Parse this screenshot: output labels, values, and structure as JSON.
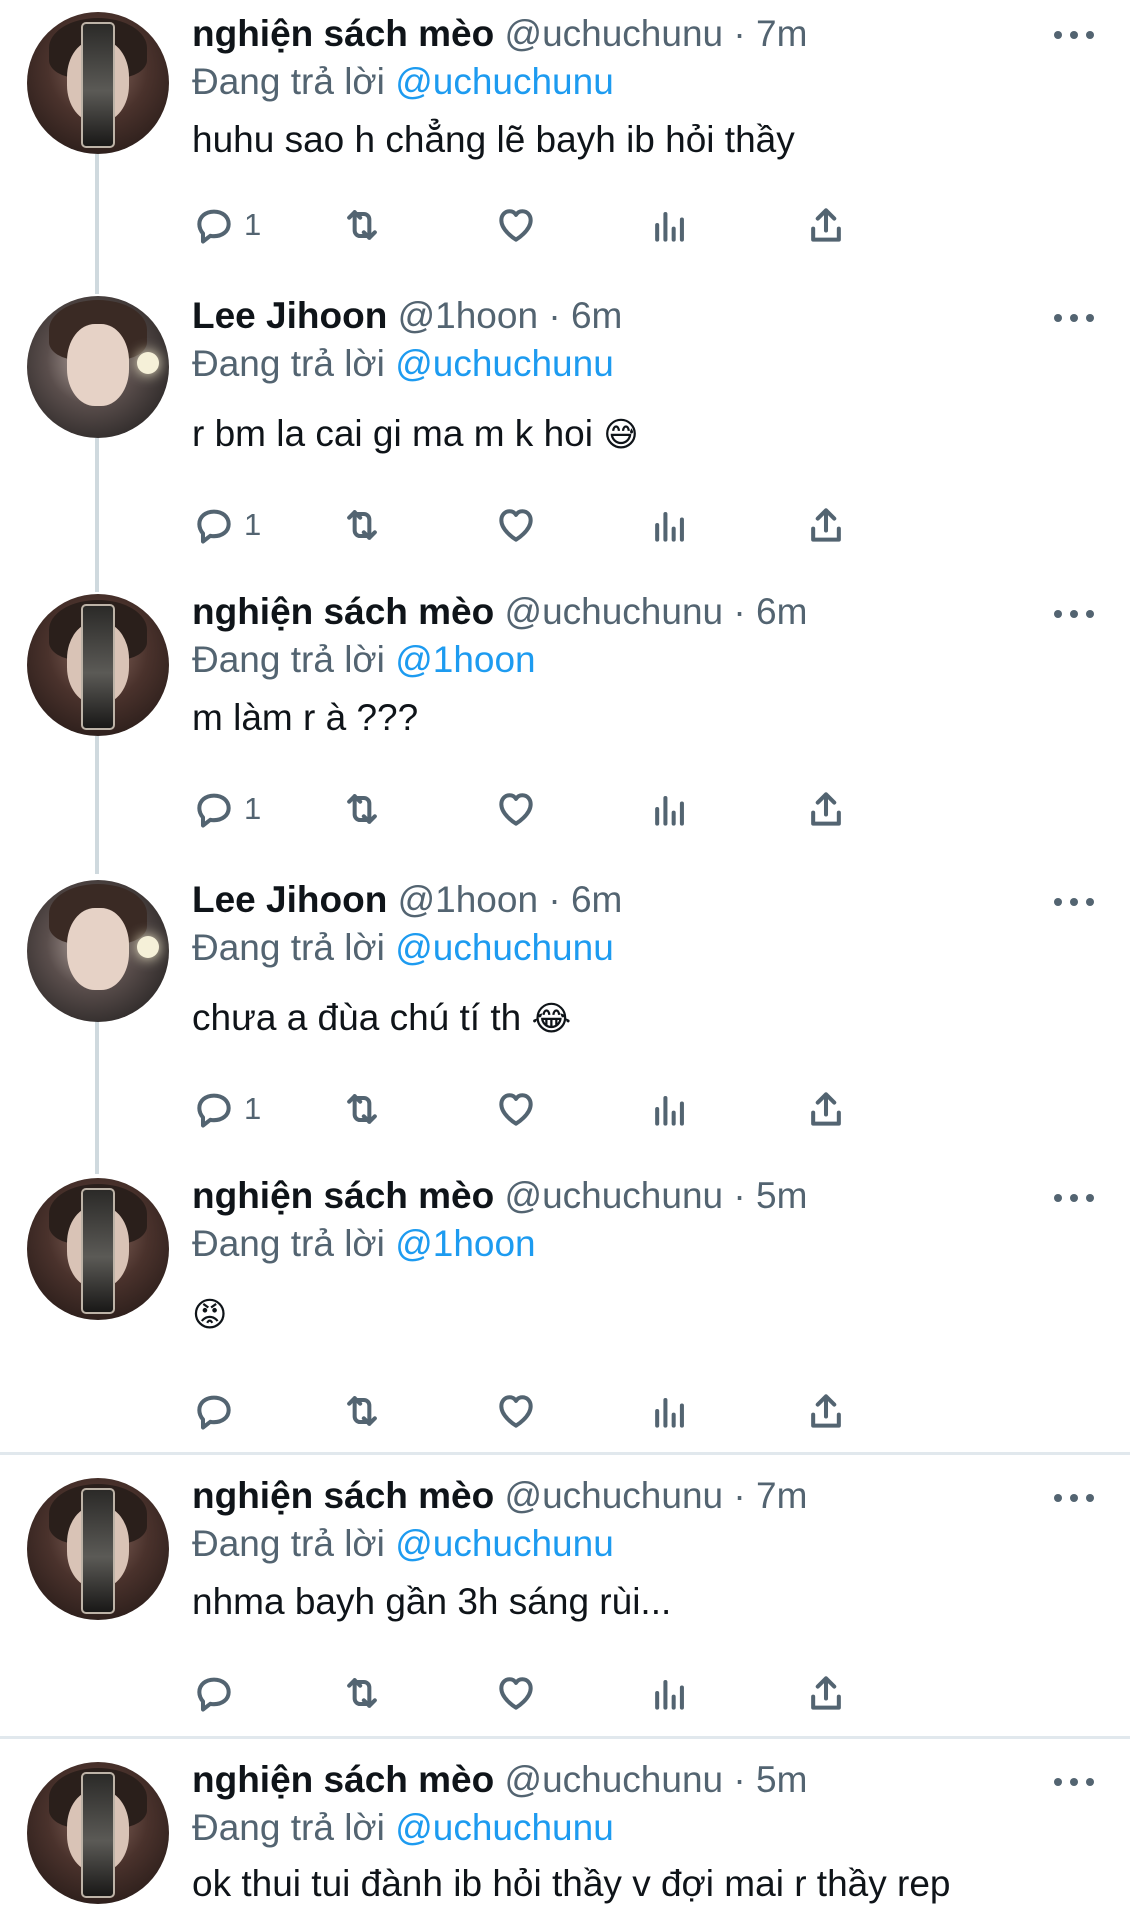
{
  "tweets": [
    {
      "name": "nghiện sách mèo",
      "handle": "@uchuchunu",
      "dot": "·",
      "time": "7m",
      "reply_prefix": "Đang trả lời",
      "reply_to": "@uchuchunu",
      "text": "huhu sao h chẳng lẽ bayh ib hỏi thầy",
      "emoji": "",
      "reply_count": "1"
    },
    {
      "name": "Lee Jihoon",
      "handle": "@1hoon",
      "dot": "·",
      "time": "6m",
      "reply_prefix": "Đang trả lời",
      "reply_to": "@uchuchunu",
      "text": "r bm la cai gi ma m k hoi",
      "emoji": "😅",
      "reply_count": "1"
    },
    {
      "name": "nghiện sách mèo",
      "handle": "@uchuchunu",
      "dot": "·",
      "time": "6m",
      "reply_prefix": "Đang trả lời",
      "reply_to": "@1hoon",
      "text": "m làm r à ???",
      "emoji": "",
      "reply_count": "1"
    },
    {
      "name": "Lee Jihoon",
      "handle": "@1hoon",
      "dot": "·",
      "time": "6m",
      "reply_prefix": "Đang trả lời",
      "reply_to": "@uchuchunu",
      "text": "chưa a đùa chú tí th",
      "emoji": "😂",
      "reply_count": "1"
    },
    {
      "name": "nghiện sách mèo",
      "handle": "@uchuchunu",
      "dot": "·",
      "time": "5m",
      "reply_prefix": "Đang trả lời",
      "reply_to": "@1hoon",
      "text": "",
      "emoji": "😡",
      "reply_count": ""
    },
    {
      "name": "nghiện sách mèo",
      "handle": "@uchuchunu",
      "dot": "·",
      "time": "7m",
      "reply_prefix": "Đang trả lời",
      "reply_to": "@uchuchunu",
      "text": "nhma bayh gần 3h sáng rùi...",
      "emoji": "",
      "reply_count": ""
    },
    {
      "name": "nghiện sách mèo",
      "handle": "@uchuchunu",
      "dot": "·",
      "time": "5m",
      "reply_prefix": "Đang trả lời",
      "reply_to": "@uchuchunu",
      "text": "ok thui tui đành ib hỏi thầy v đợi mai r thầy rep",
      "emoji": "",
      "reply_count": ""
    }
  ],
  "icons": {
    "reply": "reply-icon",
    "retweet": "retweet-icon",
    "like": "heart-icon",
    "analytics": "analytics-icon",
    "share": "share-icon",
    "more": "more-icon"
  },
  "colors": {
    "text": "#0f1419",
    "secondary": "#536471",
    "mention": "#1d9bf0",
    "divider": "#e1e8ed",
    "thread_line": "#cfd9de"
  }
}
